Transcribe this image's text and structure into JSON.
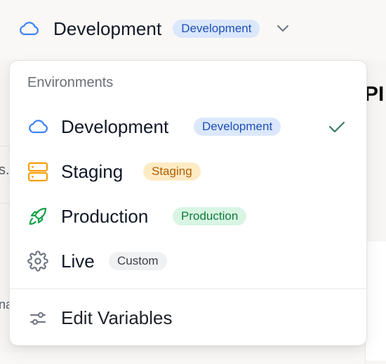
{
  "header": {
    "title": "Development",
    "badge": "Development",
    "cloud_color": "#3b82f6"
  },
  "background": {
    "frag_left_1": "s.",
    "frag_left_2": "na",
    "frag_title": "PI"
  },
  "dropdown": {
    "section_label": "Environments",
    "items": [
      {
        "icon": "cloud-icon",
        "label": "Development",
        "badge": "Development",
        "selected": true
      },
      {
        "icon": "server-icon",
        "label": "Staging",
        "badge": "Staging",
        "selected": false
      },
      {
        "icon": "rocket-icon",
        "label": "Production",
        "badge": "Production",
        "selected": false
      },
      {
        "icon": "gear-icon",
        "label": "Live",
        "badge": "Custom",
        "selected": false
      }
    ],
    "edit_label": "Edit Variables"
  },
  "colors": {
    "accent_blue": "#3b82f6",
    "staging_orange": "#f59e0b",
    "production_green": "#16a34a",
    "check_green": "#3b7a68"
  }
}
